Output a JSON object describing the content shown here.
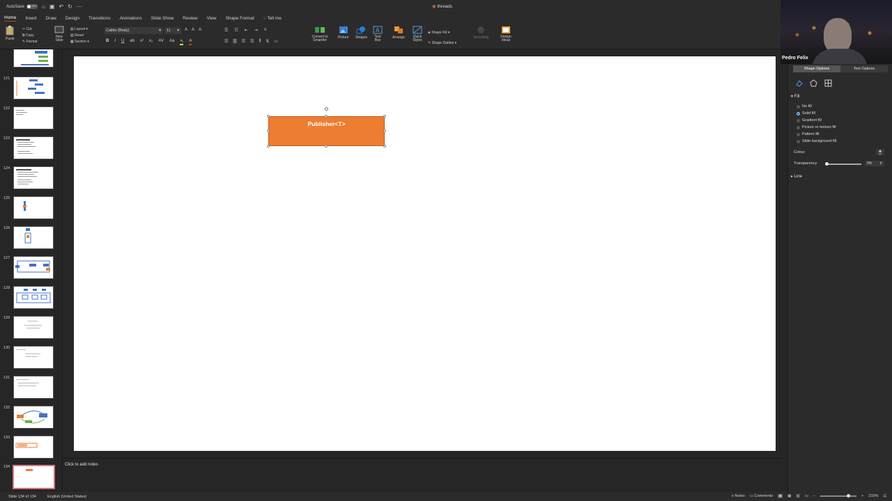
{
  "titlebar": {
    "autosave_label": "AutoSave",
    "autosave_state": "OFF",
    "doc_title": "threads"
  },
  "tabs": [
    "Home",
    "Insert",
    "Draw",
    "Design",
    "Transitions",
    "Animations",
    "Slide Show",
    "Review",
    "View",
    "Shape Format",
    "Tell me"
  ],
  "ribbon": {
    "paste": "Paste",
    "cut": "Cut",
    "copy": "Copy",
    "format": "Format",
    "new_slide": "New Slide",
    "layout": "Layout",
    "reset": "Reset",
    "section": "Section",
    "font_name": "Calibri (Body)",
    "font_size": "11",
    "convert_smartart": "Convert to SmartArt",
    "picture": "Picture",
    "shapes": "Shapes",
    "text_box": "Text Box",
    "arrange": "Arrange",
    "quick_styles": "Quick Styles",
    "shape_fill": "Shape Fill",
    "shape_outline": "Shape Outline",
    "sensitivity": "Sensitivity",
    "design_ideas": "Design Ideas"
  },
  "webcam": {
    "name": "Pedro Felix"
  },
  "thumbnails": {
    "numbers": [
      "121",
      "122",
      "123",
      "124",
      "125",
      "126",
      "127",
      "128",
      "129",
      "130",
      "131",
      "132",
      "133",
      "134"
    ],
    "selected": "134"
  },
  "slide": {
    "shape_text": "Publisher<T>"
  },
  "notes": {
    "placeholder": "Click to add notes"
  },
  "format_pane": {
    "tab_shape": "Shape Options",
    "tab_text": "Text Options",
    "fill_header": "Fill",
    "fill_options": [
      "No fill",
      "Solid fill",
      "Gradient fill",
      "Picture or texture fill",
      "Pattern fill",
      "Slide background fill"
    ],
    "selected_fill": "Solid fill",
    "colour_label": "Colour",
    "transparency_label": "Transparency",
    "transparency_value": "0%",
    "transparency_level": 0,
    "line_header": "Line",
    "accent_color": "#ed7d31"
  },
  "statusbar": {
    "slide_info": "Slide 134 of 134",
    "language": "English (United States)",
    "notes": "Notes",
    "comments": "Comments",
    "zoom": "210%"
  }
}
